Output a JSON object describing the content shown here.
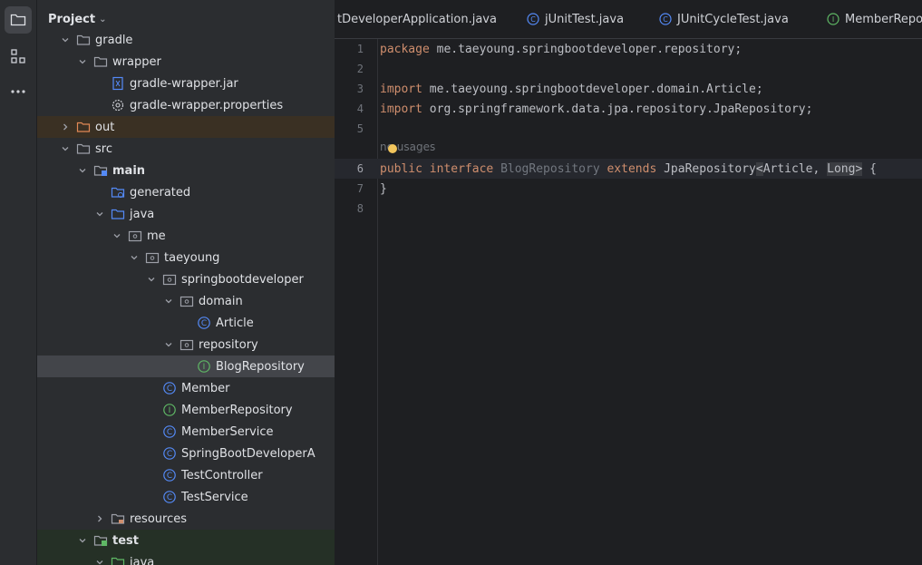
{
  "project_panel": {
    "title": "Project",
    "tree": [
      {
        "label": "gradle",
        "icon": "folder-icon",
        "expanded": true
      },
      {
        "label": "wrapper",
        "icon": "folder-icon",
        "expanded": true
      },
      {
        "label": "gradle-wrapper.jar",
        "icon": "jar-file-icon"
      },
      {
        "label": "gradle-wrapper.properties",
        "icon": "settings-file-icon"
      },
      {
        "label": "out",
        "icon": "excluded-folder-icon",
        "expanded": false
      },
      {
        "label": "src",
        "icon": "folder-icon",
        "expanded": true
      },
      {
        "label": "main",
        "icon": "source-folder-icon",
        "expanded": true
      },
      {
        "label": "generated",
        "icon": "generated-folder-icon"
      },
      {
        "label": "java",
        "icon": "source-root-icon",
        "expanded": true
      },
      {
        "label": "me",
        "icon": "package-icon",
        "expanded": true
      },
      {
        "label": "taeyoung",
        "icon": "package-icon",
        "expanded": true
      },
      {
        "label": "springbootdeveloper",
        "icon": "package-icon",
        "expanded": true
      },
      {
        "label": "domain",
        "icon": "package-icon",
        "expanded": true
      },
      {
        "label": "Article",
        "icon": "class-icon"
      },
      {
        "label": "repository",
        "icon": "package-icon",
        "expanded": true
      },
      {
        "label": "BlogRepository",
        "icon": "interface-icon",
        "selected": true
      },
      {
        "label": "Member",
        "icon": "class-icon"
      },
      {
        "label": "MemberRepository",
        "icon": "interface-icon"
      },
      {
        "label": "MemberService",
        "icon": "class-icon"
      },
      {
        "label": "SpringBootDeveloperA",
        "icon": "class-icon"
      },
      {
        "label": "TestController",
        "icon": "class-icon"
      },
      {
        "label": "TestService",
        "icon": "class-icon"
      },
      {
        "label": "resources",
        "icon": "resources-folder-icon",
        "expanded": false
      },
      {
        "label": "test",
        "icon": "test-folder-icon",
        "expanded": true
      },
      {
        "label": "java",
        "icon": "test-root-icon",
        "expanded": true
      }
    ]
  },
  "tabs": [
    {
      "label": "tDeveloperApplication.java",
      "icon": "none"
    },
    {
      "label": "jUnitTest.java",
      "icon": "class-icon"
    },
    {
      "label": "JUnitCycleTest.java",
      "icon": "class-icon"
    },
    {
      "label": "MemberRepo",
      "icon": "interface-icon"
    }
  ],
  "editor": {
    "line_numbers": [
      "1",
      "2",
      "3",
      "4",
      "5",
      "6",
      "7",
      "8"
    ],
    "current_line": "6",
    "inlay_hint": "no usages",
    "code": {
      "l1_kw": "package",
      "l1_rest": " me.taeyoung.springbootdeveloper.repository;",
      "l3_kw": "import",
      "l3_rest": " me.taeyoung.springbootdeveloper.domain.Article;",
      "l4_kw": "import",
      "l4_rest": " org.springframework.data.jpa.repository.JpaRepository;",
      "l6_kw1": "public",
      "l6_kw2": "interface",
      "l6_name": "BlogRepository",
      "l6_kw3": "extends",
      "l6_type": "JpaRepository",
      "l6_lt": "<",
      "l6_arg1": "Article, ",
      "l6_arg2": "Long",
      "l6_gt": ">",
      "l6_brace": " {",
      "l7": "}"
    }
  },
  "colors": {
    "class_icon": "#548af7",
    "interface_icon": "#5fb865",
    "keyword": "#cf8e6d",
    "folder": "#9da0a8",
    "excluded_folder": "#e08855"
  }
}
